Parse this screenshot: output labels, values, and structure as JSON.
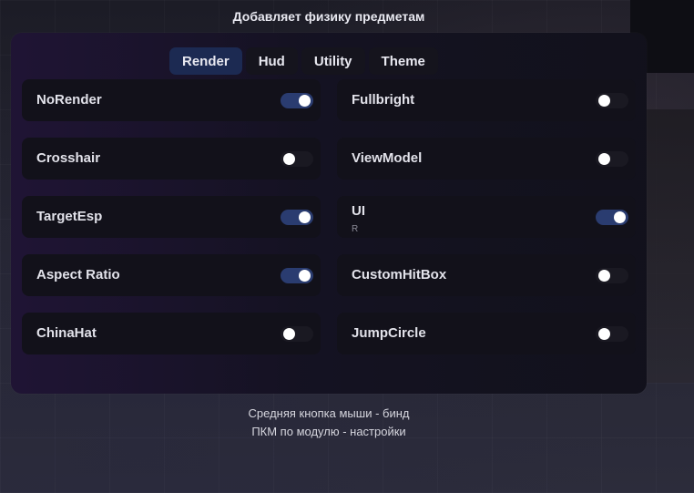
{
  "description": "Добавляет физику предметам",
  "tabs": [
    {
      "label": "Render",
      "active": true
    },
    {
      "label": "Hud",
      "active": false
    },
    {
      "label": "Utility",
      "active": false
    },
    {
      "label": "Theme",
      "active": false
    }
  ],
  "modules": [
    {
      "name": "NoRender",
      "enabled": true,
      "bind": ""
    },
    {
      "name": "Fullbright",
      "enabled": false,
      "bind": ""
    },
    {
      "name": "Crosshair",
      "enabled": false,
      "bind": ""
    },
    {
      "name": "ViewModel",
      "enabled": false,
      "bind": ""
    },
    {
      "name": "TargetEsp",
      "enabled": true,
      "bind": ""
    },
    {
      "name": "UI",
      "enabled": true,
      "bind": "R"
    },
    {
      "name": "Aspect Ratio",
      "enabled": true,
      "bind": ""
    },
    {
      "name": "CustomHitBox",
      "enabled": false,
      "bind": ""
    },
    {
      "name": "ChinaHat",
      "enabled": false,
      "bind": ""
    },
    {
      "name": "JumpCircle",
      "enabled": false,
      "bind": ""
    }
  ],
  "footer": {
    "line1": "Средняя кнопка мыши - бинд",
    "line2": "ПКМ по модулю - настройки"
  },
  "colors": {
    "toggle_on": "#2a3c70",
    "active_tab": "#1c2a52"
  }
}
